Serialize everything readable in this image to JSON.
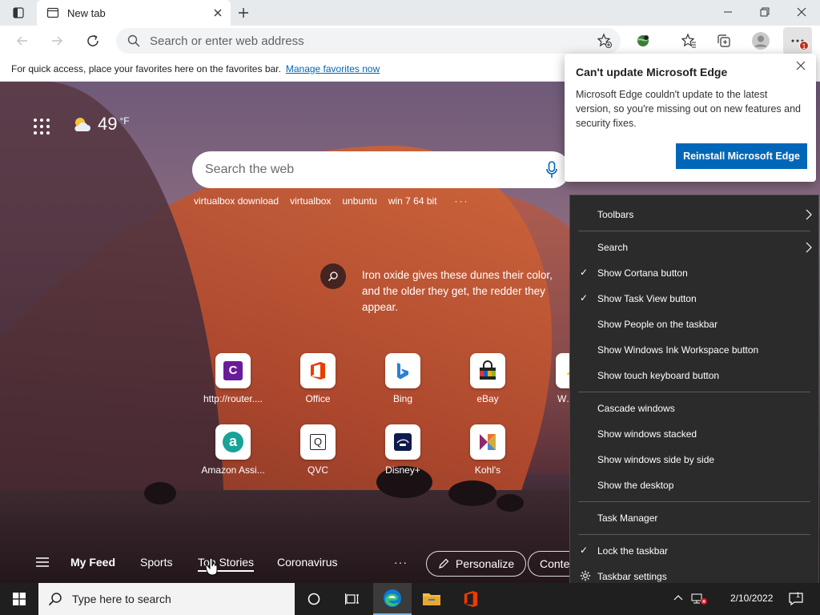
{
  "browser": {
    "tab_title": "New tab",
    "address_placeholder": "Search or enter web address",
    "notification_count": "1"
  },
  "favbar": {
    "message": "For quick access, place your favorites here on the favorites bar.",
    "link": "Manage favorites now"
  },
  "newtab": {
    "temperature": "49",
    "temp_unit": "°F",
    "search_placeholder": "Search the web",
    "chips": [
      "virtualbox download",
      "virtualbox",
      "unbuntu",
      "win 7 64 bit"
    ],
    "fact": "Iron oxide gives these dunes their color, and the older they get, the redder they appear.",
    "tiles_row1": [
      {
        "label": "http://router....",
        "letter": "C"
      },
      {
        "label": "Office"
      },
      {
        "label": "Bing"
      },
      {
        "label": "eBay"
      },
      {
        "label": "Wa"
      }
    ],
    "tiles_row2": [
      {
        "label": "Amazon Assi...",
        "letter": "a"
      },
      {
        "label": "QVC",
        "letter": "Q"
      },
      {
        "label": "Disney+"
      },
      {
        "label": "Kohl's"
      }
    ],
    "feed": {
      "my_feed": "My Feed",
      "sports": "Sports",
      "top_stories": "Top Stories",
      "coronavirus": "Coronavirus",
      "more": "···",
      "personalize": "Personalize",
      "content": "Conte"
    }
  },
  "notice": {
    "title": "Can't update Microsoft Edge",
    "body": "Microsoft Edge couldn't update to the latest version, so you're missing out on new features and security fixes.",
    "button": "Reinstall Microsoft Edge"
  },
  "context_menu": {
    "toolbars": "Toolbars",
    "search": "Search",
    "show_cortana": "Show Cortana button",
    "show_task_view": "Show Task View button",
    "show_people": "Show People on the taskbar",
    "show_ink": "Show Windows Ink Workspace button",
    "show_touch_kb": "Show touch keyboard button",
    "cascade": "Cascade windows",
    "stacked": "Show windows stacked",
    "side_by_side": "Show windows side by side",
    "desktop": "Show the desktop",
    "task_manager": "Task Manager",
    "lock": "Lock the taskbar",
    "settings": "Taskbar settings",
    "checkmark": "✓"
  },
  "taskbar": {
    "search_placeholder": "Type here to search",
    "date": "2/10/2022",
    "notification_count": "1"
  },
  "colors": {
    "accent": "#0067b8",
    "menu_bg": "#2b2b2b",
    "taskbar_bg": "#1f1f1f"
  }
}
